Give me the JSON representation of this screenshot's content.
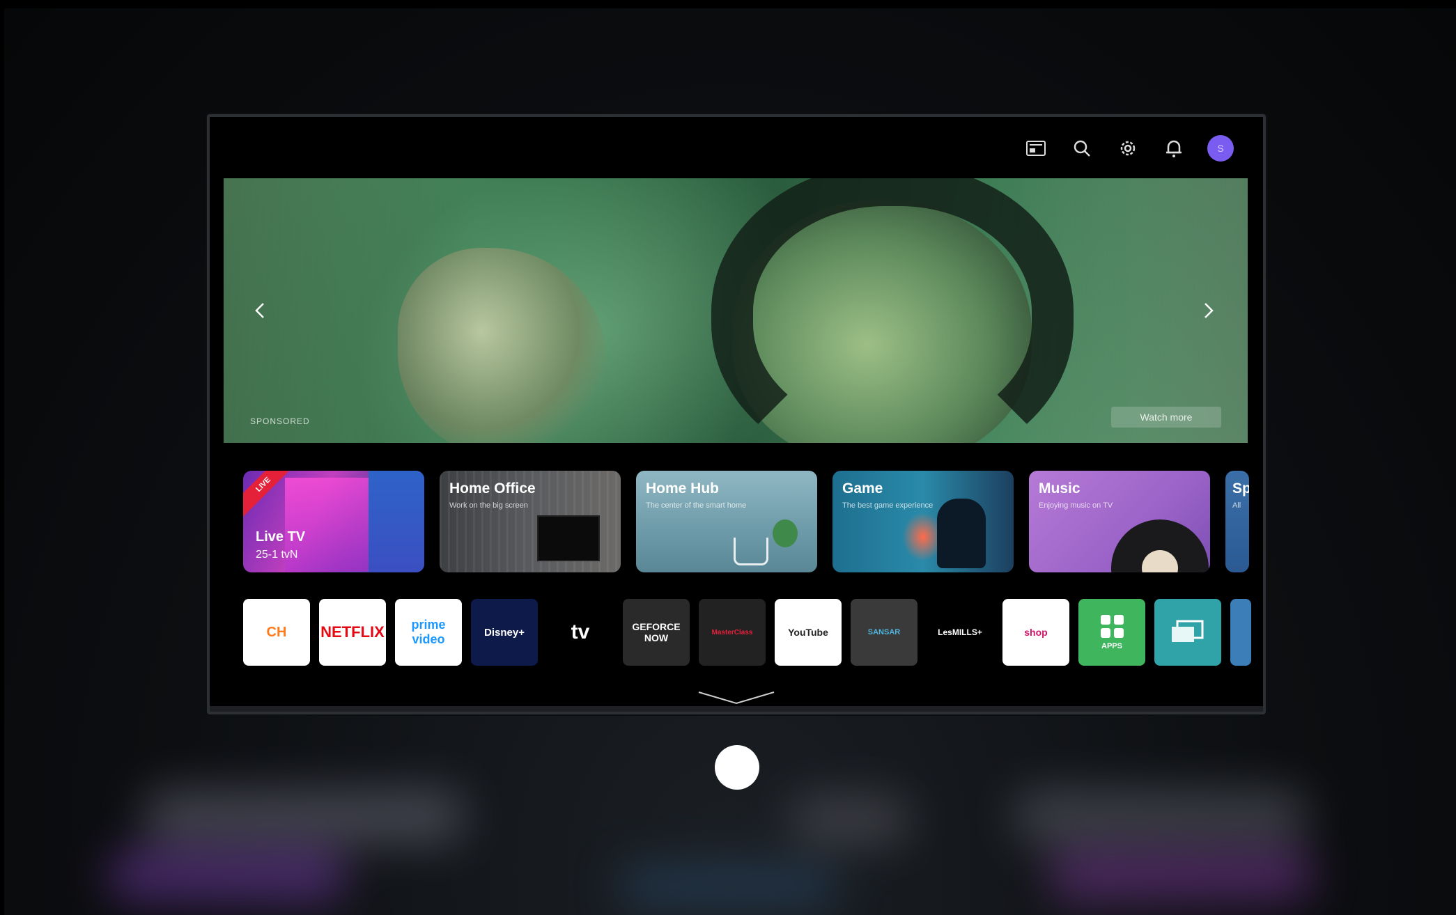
{
  "topbar": {
    "avatar_letter": "S"
  },
  "hero": {
    "sponsored": "SPONSORED",
    "watch_more": "Watch more"
  },
  "cards": [
    {
      "title": "Live TV",
      "subtitle": "25-1  tvN",
      "badge": "LIVE"
    },
    {
      "title": "Home Office",
      "subtitle": "Work on the big screen"
    },
    {
      "title": "Home Hub",
      "subtitle": "The center of the smart home"
    },
    {
      "title": "Game",
      "subtitle": "The best game experience"
    },
    {
      "title": "Music",
      "subtitle": "Enjoying music on TV"
    },
    {
      "title": "Sp",
      "subtitle": "All"
    }
  ],
  "apps": [
    {
      "label": "CH",
      "bg": "#ffffff",
      "fg": "#ff7a1a"
    },
    {
      "label": "NETFLIX",
      "bg": "#ffffff",
      "fg": "#e50914"
    },
    {
      "label": "prime video",
      "bg": "#ffffff",
      "fg": "#1a98ff"
    },
    {
      "label": "Disney+",
      "bg": "#0e1a4a",
      "fg": "#ffffff"
    },
    {
      "label": "tv",
      "bg": "#000000",
      "fg": "#ffffff"
    },
    {
      "label": "GEFORCE NOW",
      "bg": "#2a2a2a",
      "fg": "#ffffff"
    },
    {
      "label": "MasterClass",
      "bg": "#222222",
      "fg": "#e5203a"
    },
    {
      "label": "YouTube",
      "bg": "#ffffff",
      "fg": "#222222"
    },
    {
      "label": "SANSAR",
      "bg": "#3a3a3a",
      "fg": "#4fb6e0"
    },
    {
      "label": "LesMILLS+",
      "bg": "#000000",
      "fg": "#ffffff"
    },
    {
      "label": "shop",
      "bg": "#ffffff",
      "fg": "#d2146a"
    },
    {
      "label": "APPS",
      "bg": "#3fb65e",
      "fg": "#ffffff"
    },
    {
      "label": "",
      "bg": "#2fa3a8",
      "fg": "#ffffff"
    }
  ],
  "colors": {
    "accent_avatar": "#7a5cf0",
    "live_badge": "#e5213a"
  }
}
